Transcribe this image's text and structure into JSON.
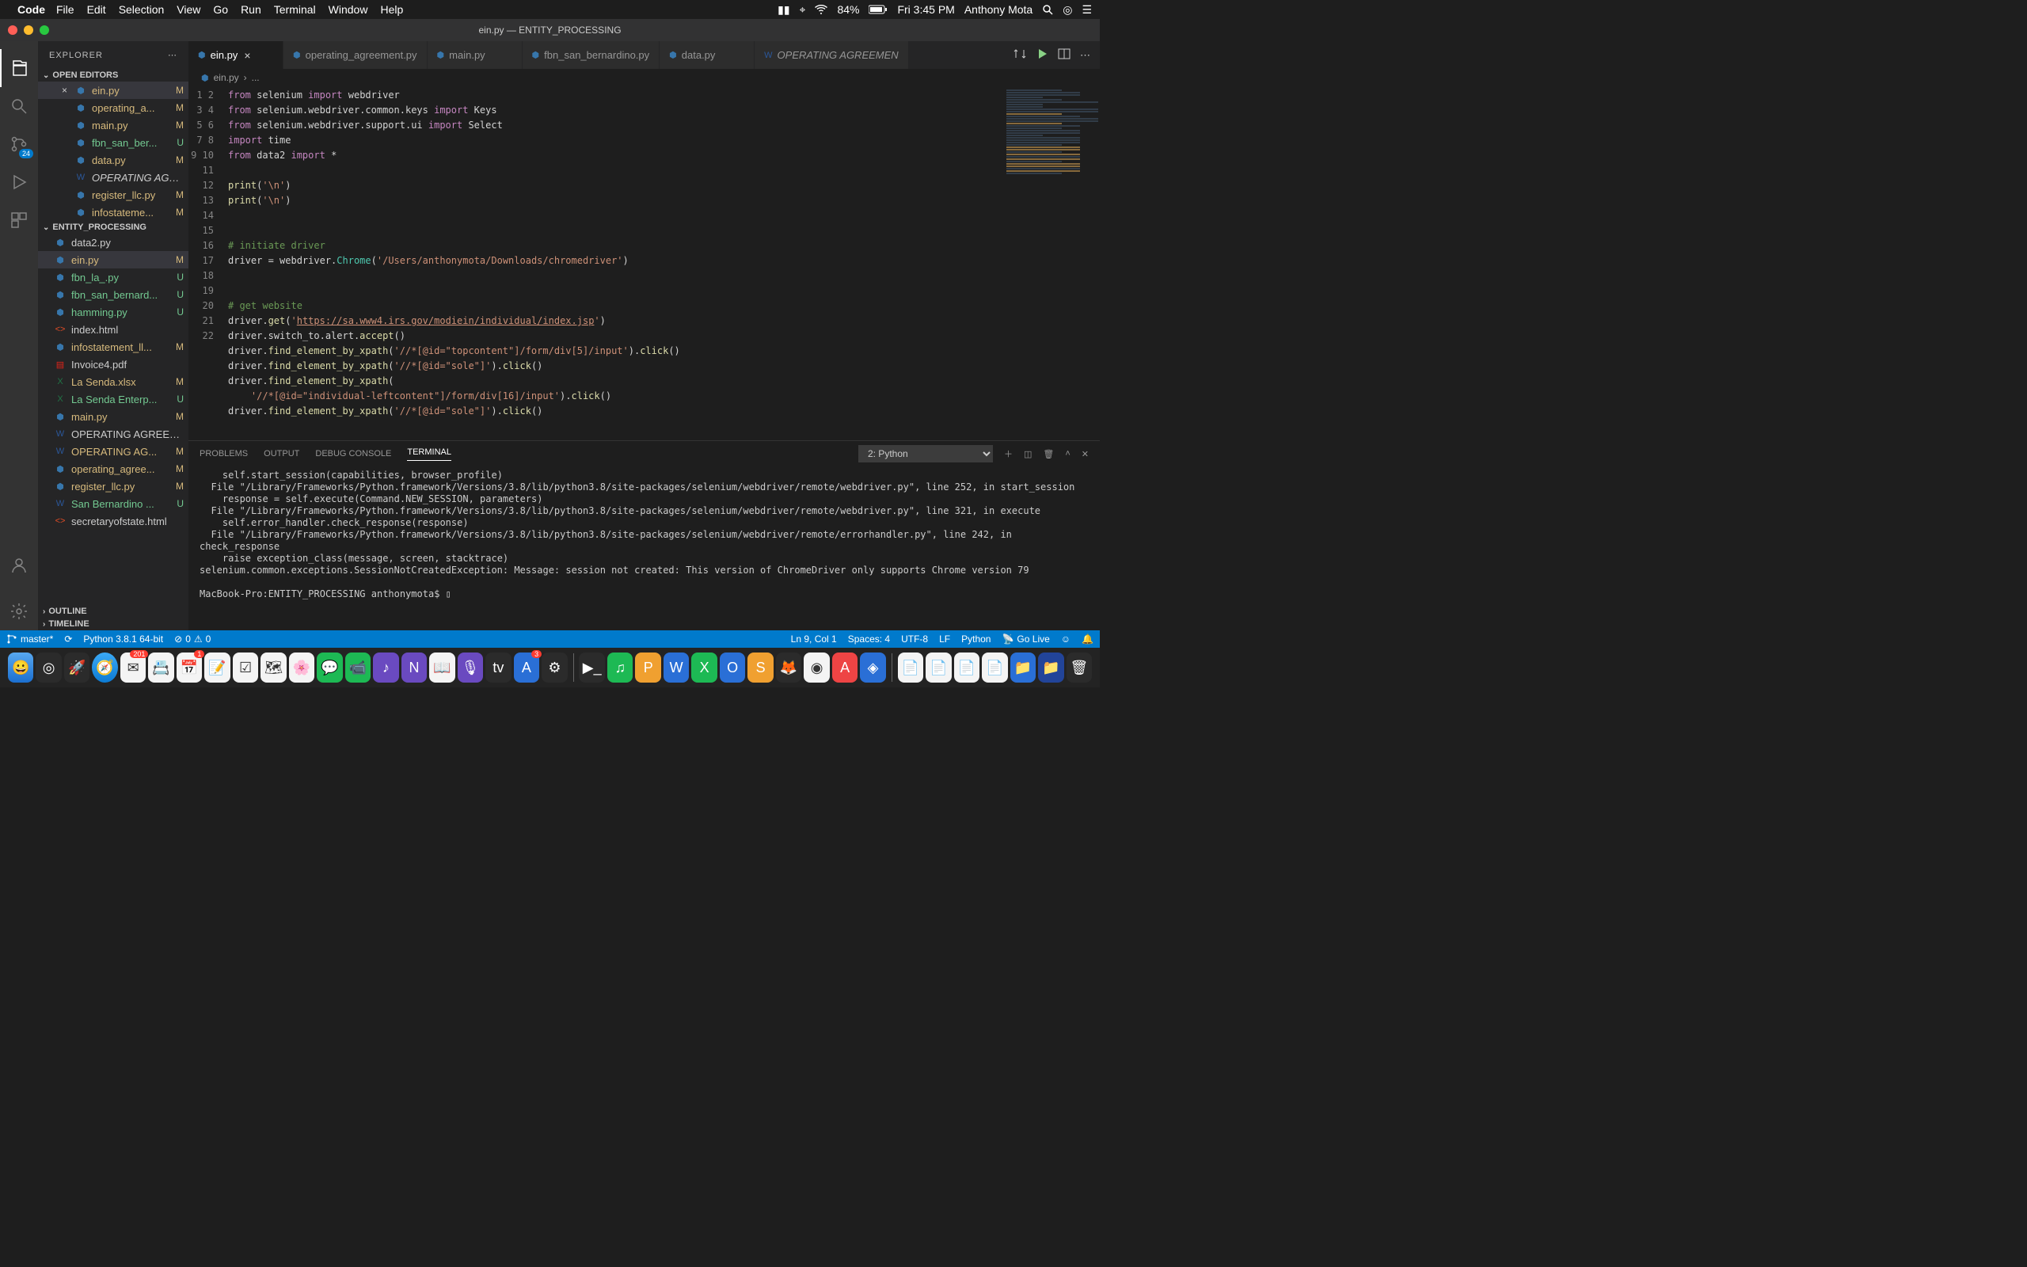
{
  "menubar": {
    "app": "Code",
    "items": [
      "File",
      "Edit",
      "Selection",
      "View",
      "Go",
      "Run",
      "Terminal",
      "Window",
      "Help"
    ],
    "battery": "84%",
    "clock": "Fri 3:45 PM",
    "user": "Anthony Mota"
  },
  "titlebar": {
    "title": "ein.py — ENTITY_PROCESSING"
  },
  "activitybar": {
    "scm_badge": "24"
  },
  "sidebar": {
    "title": "EXPLORER",
    "open_editors_label": "OPEN EDITORS",
    "project_label": "ENTITY_PROCESSING",
    "outline_label": "OUTLINE",
    "timeline_label": "TIMELINE",
    "open_editors": [
      {
        "label": "ein.py",
        "status": "M",
        "mod": "modified",
        "active": true,
        "icon": "py"
      },
      {
        "label": "operating_a...",
        "status": "M",
        "mod": "modified",
        "icon": "py"
      },
      {
        "label": "main.py",
        "status": "M",
        "mod": "modified",
        "icon": "py"
      },
      {
        "label": "fbn_san_ber...",
        "status": "U",
        "mod": "untracked",
        "icon": "py"
      },
      {
        "label": "data.py",
        "status": "M",
        "mod": "modified",
        "icon": "py"
      },
      {
        "label": "OPERATING AGR...",
        "status": "",
        "mod": "italic",
        "icon": "word"
      },
      {
        "label": "register_llc.py",
        "status": "M",
        "mod": "modified",
        "icon": "py"
      },
      {
        "label": "infostateme...",
        "status": "M",
        "mod": "modified",
        "icon": "py"
      }
    ],
    "files": [
      {
        "label": "data2.py",
        "status": "",
        "icon": "py"
      },
      {
        "label": "ein.py",
        "status": "M",
        "mod": "modified",
        "icon": "py",
        "sel": true
      },
      {
        "label": "fbn_la_.py",
        "status": "U",
        "mod": "untracked",
        "icon": "py"
      },
      {
        "label": "fbn_san_bernard...",
        "status": "U",
        "mod": "untracked",
        "icon": "py"
      },
      {
        "label": "hamming.py",
        "status": "U",
        "mod": "untracked",
        "icon": "py"
      },
      {
        "label": "index.html",
        "status": "",
        "icon": "html"
      },
      {
        "label": "infostatement_ll...",
        "status": "M",
        "mod": "modified",
        "icon": "py"
      },
      {
        "label": "Invoice4.pdf",
        "status": "",
        "icon": "pdf"
      },
      {
        "label": "La Senda.xlsx",
        "status": "M",
        "mod": "modified",
        "icon": "excel"
      },
      {
        "label": "La Senda Enterp...",
        "status": "U",
        "mod": "untracked",
        "icon": "excel"
      },
      {
        "label": "main.py",
        "status": "M",
        "mod": "modified",
        "icon": "py"
      },
      {
        "label": "OPERATING AGREEM...",
        "status": "",
        "icon": "word"
      },
      {
        "label": "OPERATING AG...",
        "status": "M",
        "mod": "modified",
        "icon": "word"
      },
      {
        "label": "operating_agree...",
        "status": "M",
        "mod": "modified",
        "icon": "py"
      },
      {
        "label": "register_llc.py",
        "status": "M",
        "mod": "modified",
        "icon": "py"
      },
      {
        "label": "San Bernardino ...",
        "status": "U",
        "mod": "untracked",
        "icon": "word"
      },
      {
        "label": "secretaryofstate.html",
        "status": "",
        "icon": "html"
      }
    ]
  },
  "tabs": [
    {
      "label": "ein.py",
      "active": true,
      "icon": "py"
    },
    {
      "label": "operating_agreement.py",
      "icon": "py"
    },
    {
      "label": "main.py",
      "icon": "py"
    },
    {
      "label": "fbn_san_bernardino.py",
      "icon": "py"
    },
    {
      "label": "data.py",
      "icon": "py"
    },
    {
      "label": "OPERATING AGREEMEN",
      "icon": "word",
      "italic": true
    }
  ],
  "breadcrumb": {
    "file": "ein.py",
    "rest": "..."
  },
  "code_lines": [
    {
      "n": 1,
      "html": "<span class='kw'>from</span> selenium <span class='kw'>import</span> webdriver"
    },
    {
      "n": 2,
      "html": "<span class='kw'>from</span> selenium.webdriver.common.keys <span class='kw'>import</span> Keys"
    },
    {
      "n": 3,
      "html": "<span class='kw'>from</span> selenium.webdriver.support.ui <span class='kw'>import</span> Select"
    },
    {
      "n": 4,
      "html": "<span class='kw'>import</span> time"
    },
    {
      "n": 5,
      "html": "<span class='kw'>from</span> data2 <span class='kw'>import</span> *"
    },
    {
      "n": 6,
      "html": ""
    },
    {
      "n": 7,
      "html": "<span class='fn'>print</span>(<span class='str'>'\\n'</span>)"
    },
    {
      "n": 8,
      "html": "<span class='fn'>print</span>(<span class='str'>'\\n'</span>)"
    },
    {
      "n": 9,
      "html": ""
    },
    {
      "n": 10,
      "html": ""
    },
    {
      "n": 11,
      "html": "<span class='cm'># initiate driver</span>"
    },
    {
      "n": 12,
      "html": "driver = webdriver.<span class='cls'>Chrome</span>(<span class='str'>'/Users/anthonymota/Downloads/chromedriver'</span>)"
    },
    {
      "n": 13,
      "html": ""
    },
    {
      "n": 14,
      "html": ""
    },
    {
      "n": 15,
      "html": "<span class='cm'># get website</span>"
    },
    {
      "n": 16,
      "html": "driver.<span class='fn'>get</span>(<span class='str'>'<span class='url'>https://sa.www4.irs.gov/modiein/individual/index.jsp</span>'</span>)"
    },
    {
      "n": 17,
      "html": "driver.switch_to.alert.<span class='fn'>accept</span>()"
    },
    {
      "n": 18,
      "html": "driver.<span class='fn'>find_element_by_xpath</span>(<span class='str'>'//*[@id=\"topcontent\"]/form/div[5]/input'</span>).<span class='fn'>click</span>()"
    },
    {
      "n": 19,
      "html": "driver.<span class='fn'>find_element_by_xpath</span>(<span class='str'>'//*[@id=\"sole\"]'</span>).<span class='fn'>click</span>()"
    },
    {
      "n": 20,
      "html": "driver.<span class='fn'>find_element_by_xpath</span>("
    },
    {
      "n": 21,
      "html": "    <span class='str'>'//*[@id=\"individual-leftcontent\"]/form/div[16]/input'</span>).<span class='fn'>click</span>()"
    },
    {
      "n": 22,
      "html": "driver.<span class='fn'>find_element_by_xpath</span>(<span class='str'>'//*[@id=\"sole\"]'</span>).<span class='fn'>click</span>()"
    }
  ],
  "panel": {
    "tabs": [
      "PROBLEMS",
      "OUTPUT",
      "DEBUG CONSOLE",
      "TERMINAL"
    ],
    "active": "TERMINAL",
    "shell_selector": "2: Python",
    "terminal_text": "    self.start_session(capabilities, browser_profile)\n  File \"/Library/Frameworks/Python.framework/Versions/3.8/lib/python3.8/site-packages/selenium/webdriver/remote/webdriver.py\", line 252, in start_session\n    response = self.execute(Command.NEW_SESSION, parameters)\n  File \"/Library/Frameworks/Python.framework/Versions/3.8/lib/python3.8/site-packages/selenium/webdriver/remote/webdriver.py\", line 321, in execute\n    self.error_handler.check_response(response)\n  File \"/Library/Frameworks/Python.framework/Versions/3.8/lib/python3.8/site-packages/selenium/webdriver/remote/errorhandler.py\", line 242, in check_response\n    raise exception_class(message, screen, stacktrace)\nselenium.common.exceptions.SessionNotCreatedException: Message: session not created: This version of ChromeDriver only supports Chrome version 79\n\nMacBook-Pro:ENTITY_PROCESSING anthonymota$ ▯"
  },
  "statusbar": {
    "branch": "master*",
    "sync": "",
    "python": "Python 3.8.1 64-bit",
    "errors": "0",
    "warnings": "0",
    "cursor": "Ln 9, Col 1",
    "spaces": "Spaces: 4",
    "encoding": "UTF-8",
    "eol": "LF",
    "lang": "Python",
    "golive": "Go Live"
  }
}
